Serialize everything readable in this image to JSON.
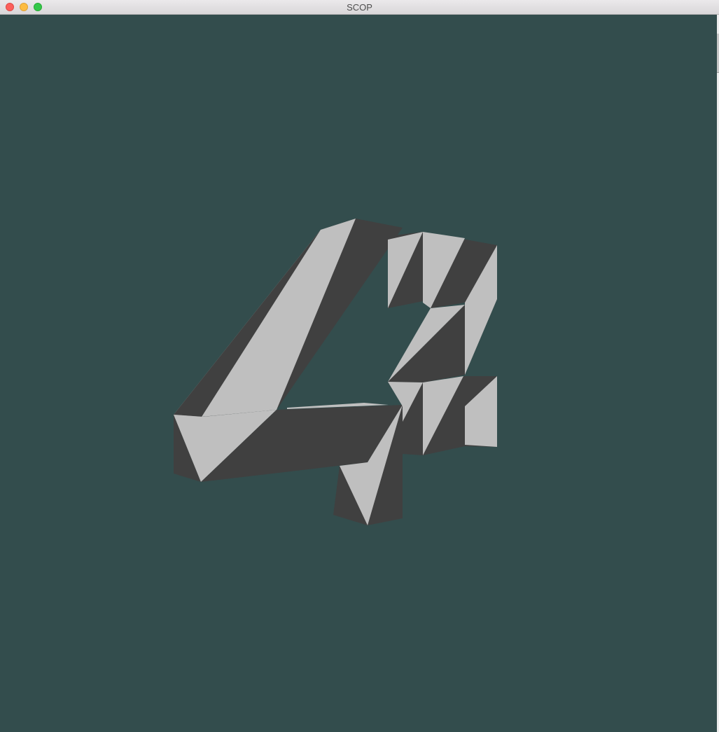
{
  "window": {
    "title": "SCOP"
  },
  "controls": {
    "close": "close-window",
    "minimize": "minimize-window",
    "zoom": "zoom-window"
  },
  "viewport": {
    "background_color": "#334d4d",
    "model": {
      "name": "4",
      "light_face_color": "#bfbfbf",
      "dark_face_color": "#404040"
    }
  }
}
